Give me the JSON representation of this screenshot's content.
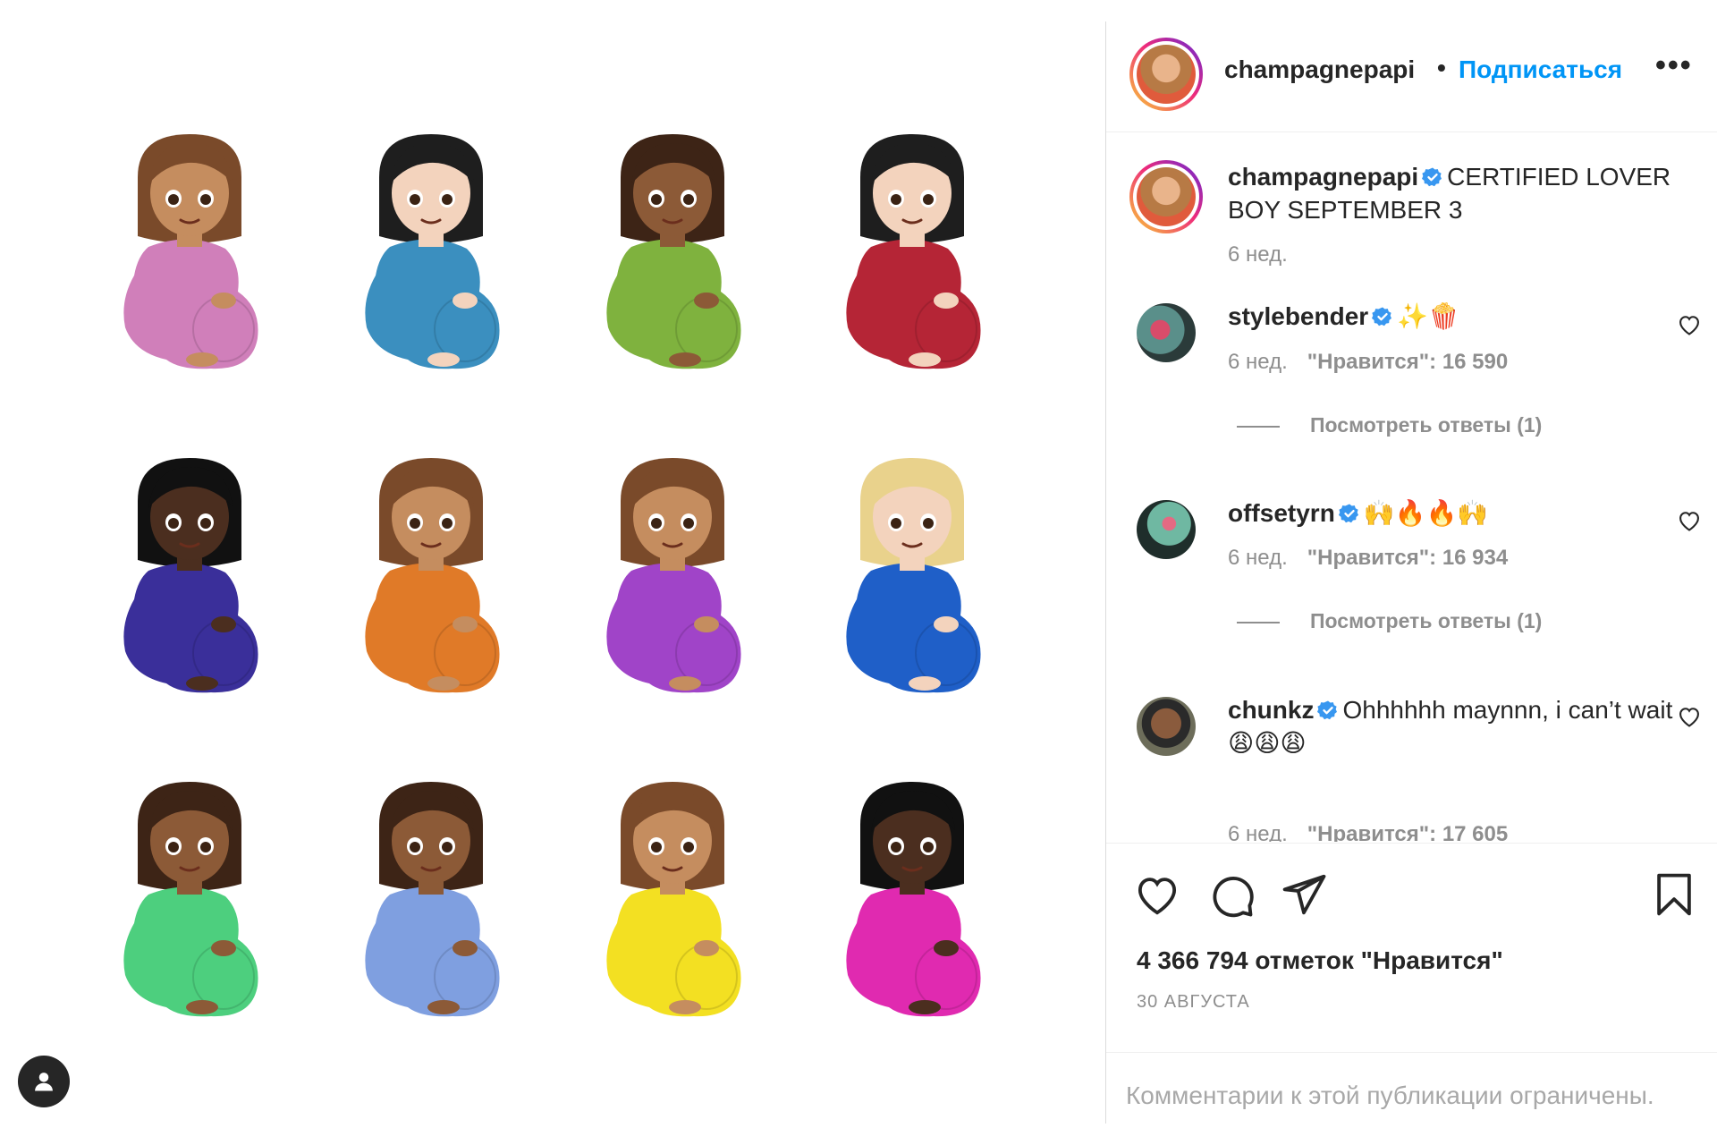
{
  "post": {
    "author": "champagnepapi",
    "follow_label": "Подписаться",
    "separator": "•",
    "more_label": "•••",
    "caption_author": "champagnepapi",
    "caption_text": "CERTIFIED LOVER BOY SEPTEMBER 3",
    "caption_time": "6 нед."
  },
  "emoji_grid": [
    {
      "hair": "#7a4a2a",
      "skin": "#c58d5f",
      "shirt": "#d07fba"
    },
    {
      "hair": "#1e1e1e",
      "skin": "#f3d3bd",
      "shirt": "#3b8fbf"
    },
    {
      "hair": "#3d2416",
      "skin": "#8c5a37",
      "shirt": "#7fb23e"
    },
    {
      "hair": "#1e1e1e",
      "skin": "#f3d3bd",
      "shirt": "#b52536"
    },
    {
      "hair": "#111111",
      "skin": "#4b2e1f",
      "shirt": "#3a2f9a"
    },
    {
      "hair": "#7a4a2a",
      "skin": "#c58d5f",
      "shirt": "#e07a28"
    },
    {
      "hair": "#7a4a2a",
      "skin": "#c58d5f",
      "shirt": "#a044c8"
    },
    {
      "hair": "#e9d28c",
      "skin": "#f3d3bd",
      "shirt": "#1f5fc8"
    },
    {
      "hair": "#3d2416",
      "skin": "#8c5a37",
      "shirt": "#4dcf7e"
    },
    {
      "hair": "#3d2416",
      "skin": "#8c5a37",
      "shirt": "#7f9fe0"
    },
    {
      "hair": "#7a4a2a",
      "skin": "#c58d5f",
      "shirt": "#f3e022"
    },
    {
      "hair": "#111111",
      "skin": "#4b2e1f",
      "shirt": "#e02ab0"
    }
  ],
  "comments": [
    {
      "user": "stylebender",
      "text": "✨🍿",
      "time": "6 нед.",
      "likes": "\"Нравится\": 16 590",
      "replies": "Посмотреть ответы (1)"
    },
    {
      "user": "offsetyrn",
      "text": "🙌🔥🔥🙌",
      "time": "6 нед.",
      "likes": "\"Нравится\": 16 934",
      "replies": "Посмотреть ответы (1)"
    },
    {
      "user": "chunkz",
      "text": "Ohhhhhh maynnn, i can’t wait 😩😩😩",
      "time": "6 нед.",
      "likes": "\"Нравится\": 17 605"
    }
  ],
  "likes_total": "4 366 794 отметок \"Нравится\"",
  "date": "30 АВГУСТА",
  "comments_limited": "Комментарии к этой публикации ограничены.",
  "colors": {
    "accent": "#0095f6",
    "verified": "#3897f0",
    "muted": "#8e8e8e"
  },
  "icons": [
    "heart-icon",
    "comment-icon",
    "share-icon",
    "bookmark-icon",
    "user-tag-icon",
    "verified-icon"
  ]
}
